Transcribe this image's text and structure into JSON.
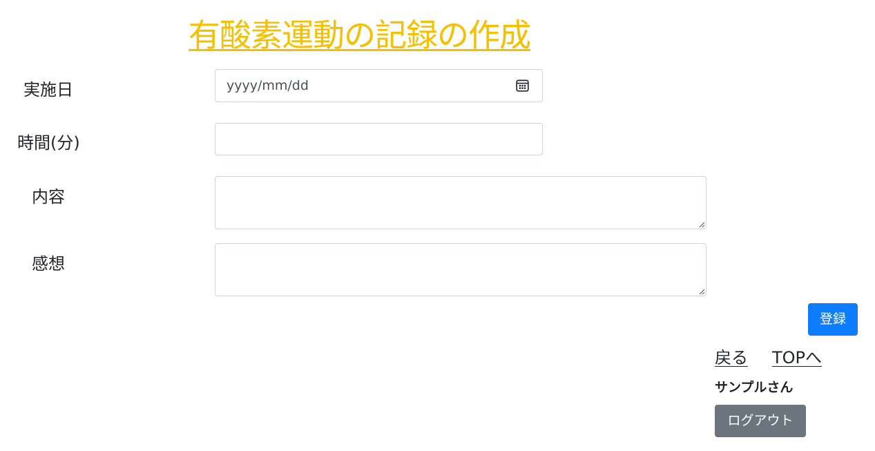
{
  "page": {
    "title": "有酸素運動の記録の作成"
  },
  "form": {
    "date": {
      "label": "実施日",
      "placeholder": "yyyy/mm/dd",
      "icon": "calendar-icon"
    },
    "minutes": {
      "label": "時間(分)",
      "value": ""
    },
    "content": {
      "label": "内容",
      "value": ""
    },
    "impression": {
      "label": "感想",
      "value": ""
    },
    "submit_label": "登録"
  },
  "nav": {
    "back_label": "戻る",
    "top_label": "TOPへ"
  },
  "user": {
    "name": "サンプルさん",
    "logout_label": "ログアウト"
  },
  "colors": {
    "title": "#f6c000",
    "primary_button": "#0d7cff",
    "secondary_button": "#6c757d",
    "input_border": "#ced4da"
  }
}
